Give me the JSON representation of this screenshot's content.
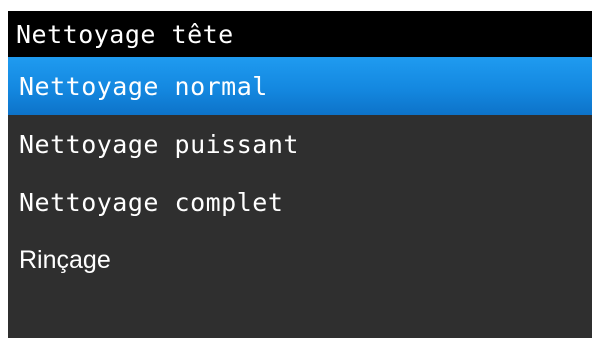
{
  "header": {
    "title": "Nettoyage tête"
  },
  "menu": {
    "items": [
      {
        "label": "Nettoyage normal",
        "selected": true
      },
      {
        "label": "Nettoyage puissant",
        "selected": false
      },
      {
        "label": "Nettoyage complet",
        "selected": false
      },
      {
        "label": "Rinçage",
        "selected": false
      }
    ]
  },
  "colors": {
    "background": "#2f2f2f",
    "title_bar": "#000000",
    "selection": "#1488e0",
    "text": "#ffffff"
  }
}
